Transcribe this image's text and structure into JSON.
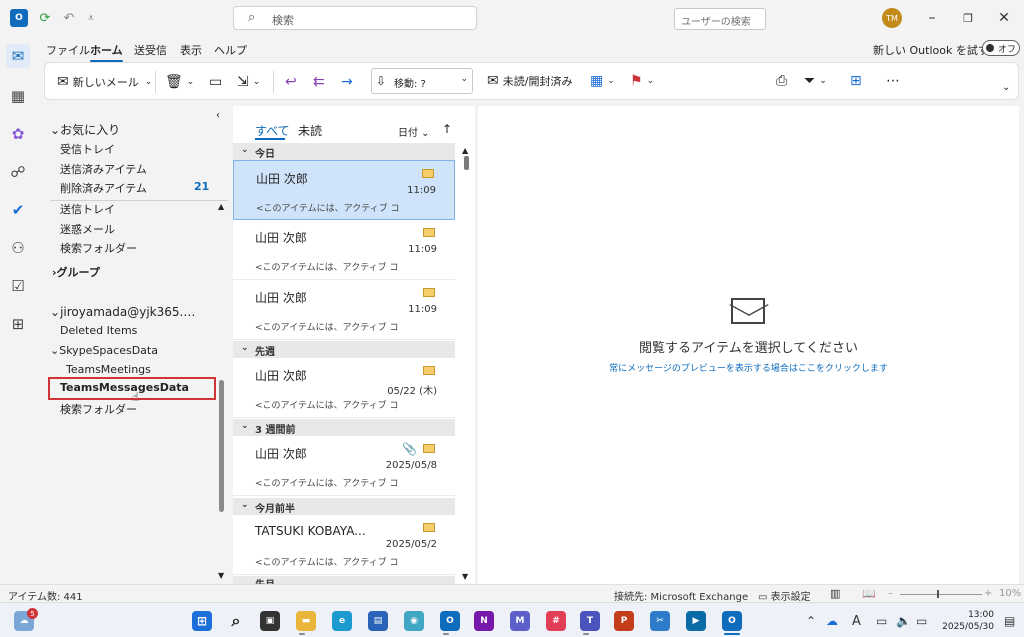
{
  "titlebar": {
    "search_placeholder": "検索",
    "avatar_initials": "TM",
    "icons": [
      "outlook-app-icon",
      "sync-icon",
      "undo-icon",
      "customize-qat-icon",
      "minimize-icon",
      "restore-icon",
      "close-icon"
    ]
  },
  "menu": {
    "tabs": [
      "ファイル",
      "ホーム",
      "送受信",
      "表示",
      "ヘルプ"
    ],
    "active_tab": "ホーム",
    "new_outlook_label": "新しい Outlook を試す",
    "toggle_label": "オフ"
  },
  "ribbon": {
    "new_mail": "新しいメール",
    "move_to": "移動: ?",
    "read_unread": "未読/開封済み",
    "user_search_placeholder": "ユーザーの検索"
  },
  "folders": {
    "favorites_header": "お気に入り",
    "favorites": [
      {
        "label": "受信トレイ"
      },
      {
        "label": "送信済みアイテム"
      },
      {
        "label": "削除済みアイテム",
        "count": "21"
      }
    ],
    "more_items": [
      "送信トレイ",
      "迷惑メール",
      "検索フォルダー"
    ],
    "groups_header": "グループ",
    "account_header": "jiroyamada@yjk365.…",
    "account_items": [
      {
        "label": "Deleted Items"
      },
      {
        "label": "SkypeSpacesData"
      },
      {
        "label": "TeamsMeetings"
      },
      {
        "label": "TeamsMessagesData",
        "selected": true
      },
      {
        "label": "検索フォルダー"
      }
    ]
  },
  "maillist": {
    "tab_all": "すべて",
    "tab_unread": "未読",
    "sort_label": "日付",
    "groups": [
      "今日",
      "先週",
      "3 週間前",
      "今月前半",
      "先月"
    ],
    "items": [
      {
        "from": "山田 次郎",
        "time": "11:09",
        "preview": "<このアイテムには、アクティブ コ",
        "selected": true
      },
      {
        "from": "山田 次郎",
        "time": "11:09",
        "preview": "<このアイテムには、アクティブ コ"
      },
      {
        "from": "山田 次郎",
        "time": "11:09",
        "preview": "<このアイテムには、アクティブ コ"
      },
      {
        "from": "山田 次郎",
        "time": "05/22 (木)",
        "preview": "<このアイテムには、アクティブ コ"
      },
      {
        "from": "山田 次郎",
        "time": "2025/05/8",
        "preview": "<このアイテムには、アクティブ コ",
        "attachment": true
      },
      {
        "from": "TATSUKI KOBAYA...",
        "time": "2025/05/2",
        "preview": "<このアイテムには、アクティブ コ"
      }
    ]
  },
  "reading": {
    "title": "閲覧するアイテムを選択してください",
    "link": "常にメッセージのプレビューを表示する場合はここをクリックします"
  },
  "status": {
    "item_count": "アイテム数: 441",
    "connection": "接続先: Microsoft Exchange",
    "display_settings": "表示設定",
    "zoom": "10%"
  },
  "taskbar": {
    "weather_badge": "5",
    "time": "13:00",
    "date": "2025/05/30"
  },
  "colors": {
    "accent": "#0f6cbd",
    "selection": "#cfe4fa",
    "highlight_border": "#d13438"
  }
}
